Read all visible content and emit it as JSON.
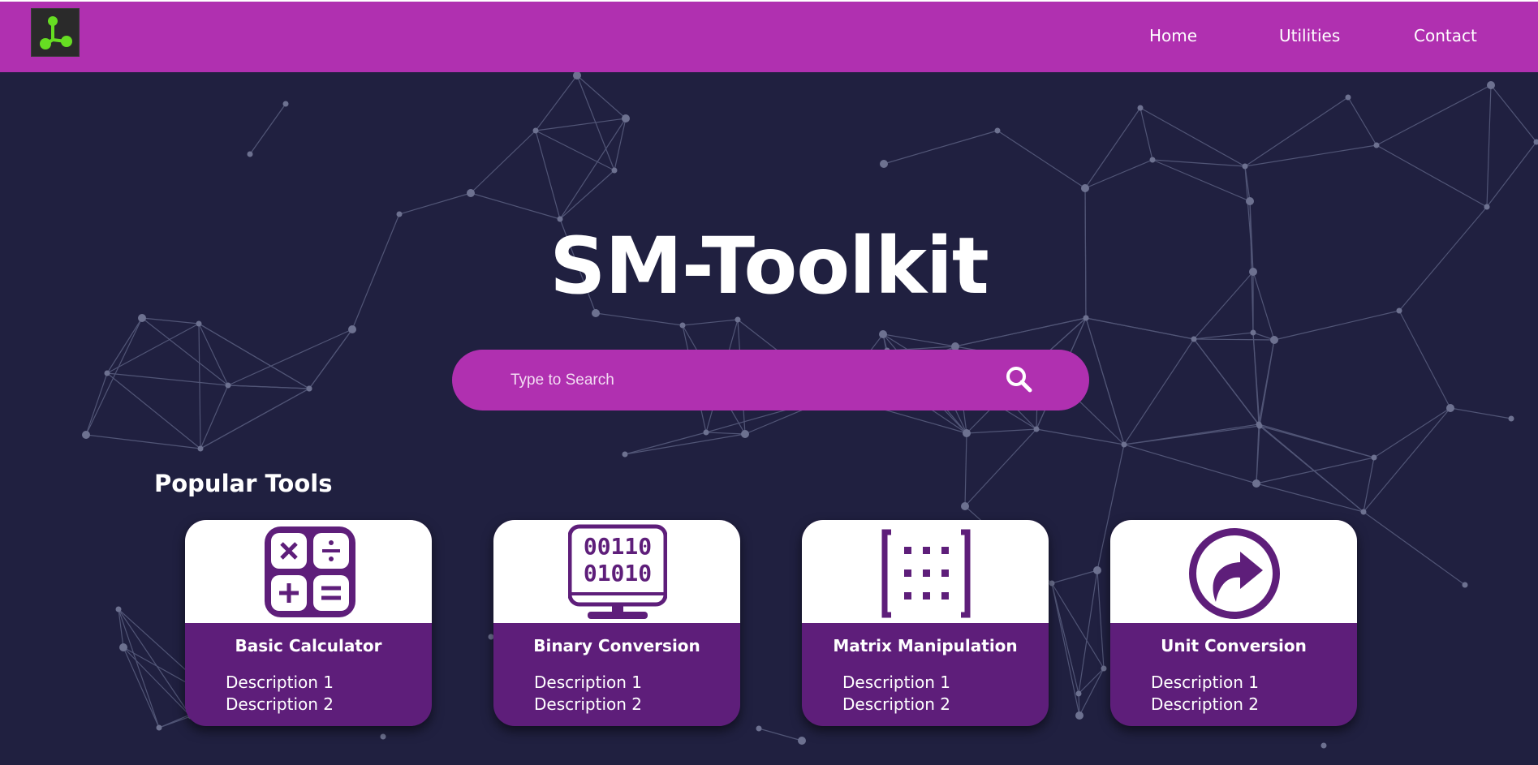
{
  "nav": {
    "links": [
      "Home",
      "Utilities",
      "Contact"
    ]
  },
  "hero": {
    "title": "SM-Toolkit",
    "search_placeholder": "Type to Search"
  },
  "section": {
    "title": "Popular Tools"
  },
  "cards": [
    {
      "title": "Basic Calculator",
      "icon": "calculator-icon",
      "descriptions": [
        "Description 1",
        "Description 2"
      ]
    },
    {
      "title": "Binary Conversion",
      "icon": "binary-monitor-icon",
      "descriptions": [
        "Description 1",
        "Description 2"
      ]
    },
    {
      "title": "Matrix Manipulation",
      "icon": "matrix-icon",
      "descriptions": [
        "Description 1",
        "Description 2"
      ]
    },
    {
      "title": "Unit Conversion",
      "icon": "conversion-arrow-icon",
      "descriptions": [
        "Description 1",
        "Description 2"
      ]
    }
  ],
  "icon_text": {
    "binary_line_1": "00110",
    "binary_line_2": "01010"
  },
  "colors": {
    "navbar": "#b030b0",
    "background": "#202040",
    "card_bottom": "#5e1e7a",
    "icon_purple": "#5e1e7a",
    "logo_green": "#66dd22"
  }
}
